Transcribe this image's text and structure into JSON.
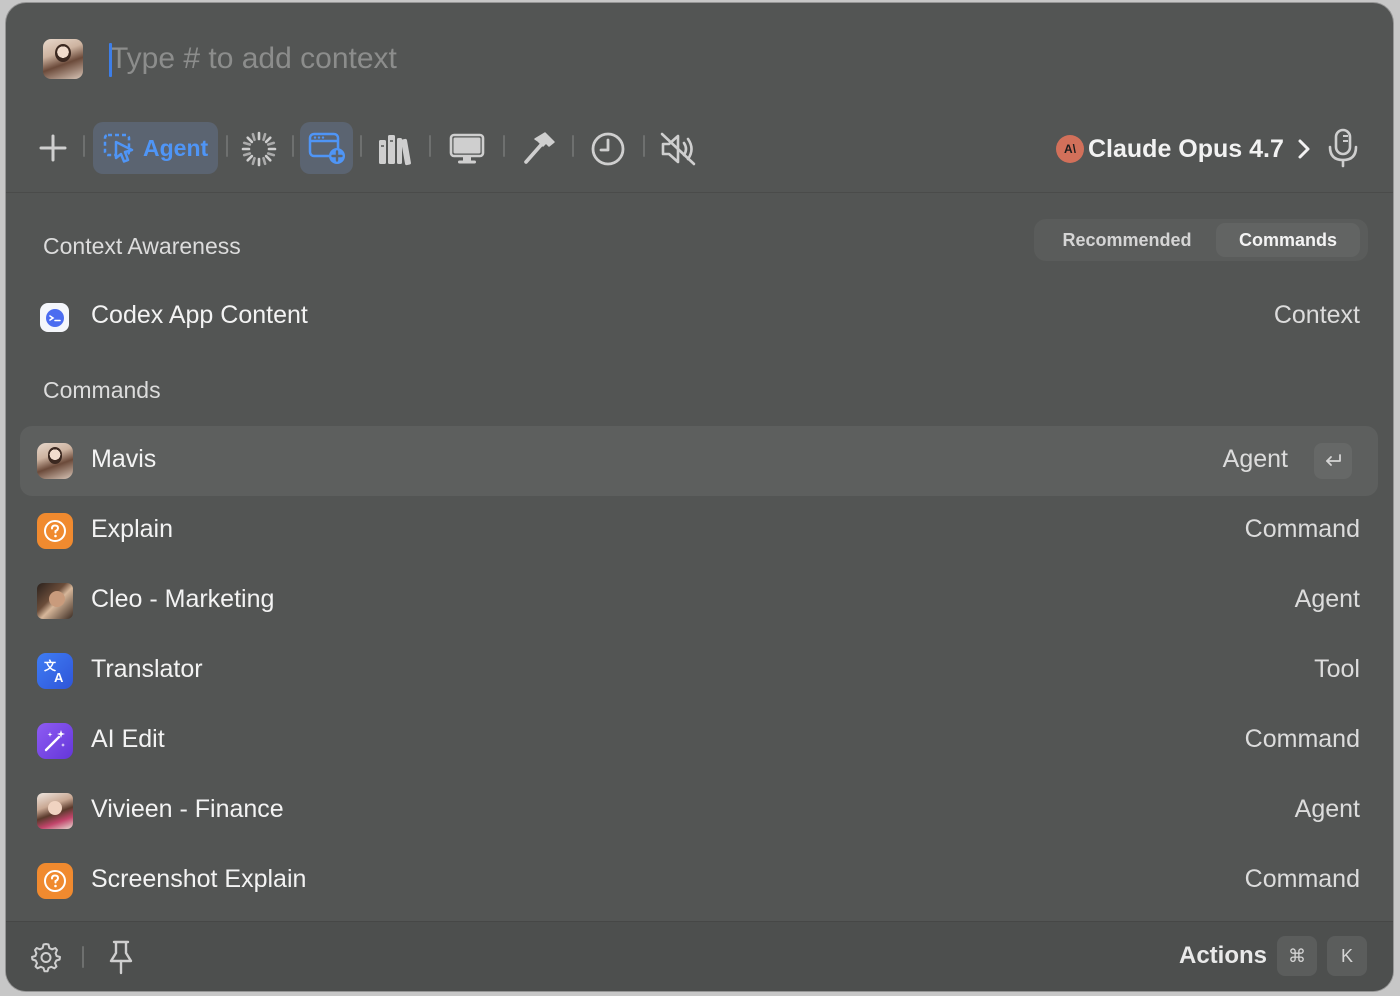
{
  "input": {
    "placeholder": "Type # to add context",
    "value": ""
  },
  "toolbar": {
    "add_icon": "plus-icon",
    "agent_label": "Agent",
    "tools": [
      "loading-spinner-icon",
      "browser-add-icon",
      "library-books-icon",
      "monitor-icon",
      "hammer-icon",
      "history-clock-icon",
      "sound-muted-icon"
    ],
    "model": {
      "badge": "A\\",
      "name": "Claude Opus 4.7",
      "chevron": "›"
    },
    "mic_icon": "microphone-icon"
  },
  "sections": {
    "context_title": "Context Awareness",
    "commands_title": "Commands"
  },
  "tabs": {
    "recommended": "Recommended",
    "commands": "Commands",
    "active": "Commands"
  },
  "context_items": [
    {
      "label": "Codex App Content",
      "type": "Context",
      "icon": "codex-app-icon"
    }
  ],
  "command_items": [
    {
      "label": "Mavis",
      "type": "Agent",
      "icon": "mavis-avatar",
      "selected": true
    },
    {
      "label": "Explain",
      "type": "Command",
      "icon": "question-icon"
    },
    {
      "label": "Cleo - Marketing",
      "type": "Agent",
      "icon": "cleo-avatar"
    },
    {
      "label": "Translator",
      "type": "Tool",
      "icon": "translate-icon"
    },
    {
      "label": "AI Edit",
      "type": "Command",
      "icon": "magic-wand-icon"
    },
    {
      "label": "Vivieen - Finance",
      "type": "Agent",
      "icon": "vivieen-avatar"
    },
    {
      "label": "Screenshot Explain",
      "type": "Command",
      "icon": "question-icon"
    }
  ],
  "footer": {
    "actions_label": "Actions",
    "shortcut_cmd": "⌘",
    "shortcut_key": "K"
  },
  "colors": {
    "background": "#535554",
    "accent": "#4f95f6",
    "orange": "#f08a2f",
    "purple": "#7b4ee8"
  }
}
